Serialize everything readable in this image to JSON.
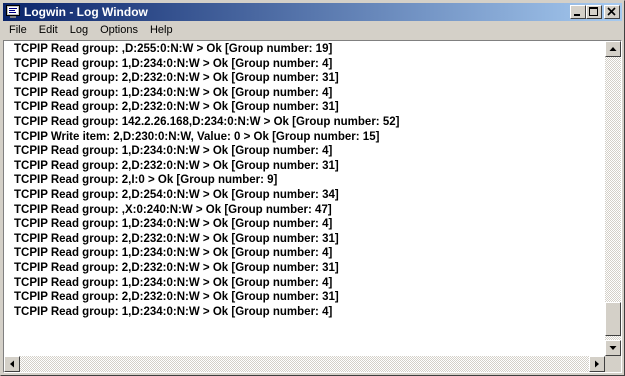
{
  "window": {
    "title": "Logwin - Log Window",
    "buttons": {
      "minimize": "_",
      "maximize": "□",
      "close": "×"
    }
  },
  "menu": {
    "items": [
      "File",
      "Edit",
      "Log",
      "Options",
      "Help"
    ]
  },
  "log": {
    "lines": [
      "TCPIP  Read group: ,D:255:0:N:W > Ok [Group number: 19]",
      "TCPIP  Read group: 1,D:234:0:N:W > Ok [Group number: 4]",
      "TCPIP  Read group: 2,D:232:0:N:W > Ok [Group number: 31]",
      "TCPIP  Read group: 1,D:234:0:N:W > Ok [Group number: 4]",
      "TCPIP  Read group: 2,D:232:0:N:W > Ok [Group number: 31]",
      "TCPIP  Read group: 142.2.26.168,D:234:0:N:W > Ok [Group number: 52]",
      "TCPIP  Write item: 2,D:230:0:N:W, Value: 0 > Ok [Group number: 15]",
      "TCPIP  Read group: 1,D:234:0:N:W > Ok [Group number: 4]",
      "TCPIP  Read group: 2,D:232:0:N:W > Ok [Group number: 31]",
      "TCPIP  Read group: 2,I:0 > Ok [Group number: 9]",
      "TCPIP  Read group: 2,D:254:0:N:W > Ok [Group number: 34]",
      "TCPIP  Read group: ,X:0:240:N:W > Ok [Group number: 47]",
      "TCPIP  Read group: 1,D:234:0:N:W > Ok [Group number: 4]",
      "TCPIP  Read group: 2,D:232:0:N:W > Ok [Group number: 31]",
      "TCPIP  Read group: 1,D:234:0:N:W > Ok [Group number: 4]",
      "TCPIP  Read group: 2,D:232:0:N:W > Ok [Group number: 31]",
      "TCPIP  Read group: 1,D:234:0:N:W > Ok [Group number: 4]",
      "TCPIP  Read group: 2,D:232:0:N:W > Ok [Group number: 31]",
      "TCPIP  Read group: 1,D:234:0:N:W > Ok [Group number: 4]"
    ]
  },
  "colors": {
    "titlebar_start": "#0a246a",
    "titlebar_end": "#a6caf0",
    "face": "#d4d0c8"
  },
  "icons": {
    "app": "log-window-icon",
    "scroll_up": "arrow-up-icon",
    "scroll_down": "arrow-down-icon",
    "scroll_left": "arrow-left-icon",
    "scroll_right": "arrow-right-icon"
  }
}
